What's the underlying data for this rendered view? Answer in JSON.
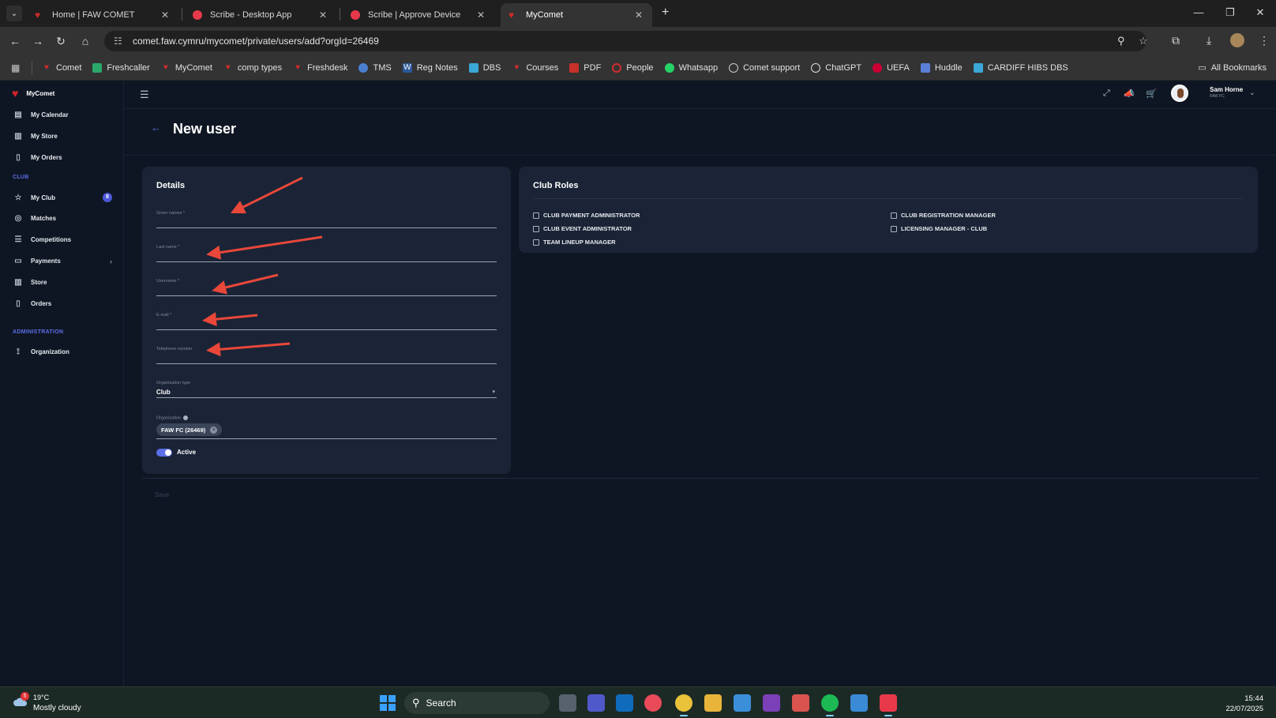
{
  "browser": {
    "tabs": [
      {
        "title": "Home | FAW COMET",
        "icon": "heart-icon",
        "active": false
      },
      {
        "title": "Scribe - Desktop App",
        "icon": "scribe-icon",
        "active": false
      },
      {
        "title": "Scribe | Approve Device",
        "icon": "scribe-icon",
        "active": false
      },
      {
        "title": "MyComet",
        "icon": "heart-icon",
        "active": true
      }
    ],
    "url": "comet.faw.cymru/mycomet/private/users/add?orgId=26469",
    "bookmarks": [
      "Comet",
      "Freshcaller",
      "MyComet",
      "comp types",
      "Freshdesk",
      "TMS",
      "Reg Notes",
      "DBS",
      "Courses",
      "PDF",
      "People",
      "Whatsapp",
      "Comet support",
      "ChatGPT",
      "UEFA",
      "Huddle",
      "CARDIFF HIBS DBS"
    ],
    "all_bookmarks": "All Bookmarks"
  },
  "sidebar": {
    "brand": "MyComet",
    "items_top": [
      "My Calendar",
      "My Store",
      "My Orders"
    ],
    "section_club": "CLUB",
    "items_club": [
      {
        "label": "My Club",
        "badge": "8"
      },
      {
        "label": "Matches"
      },
      {
        "label": "Competitions"
      },
      {
        "label": "Payments"
      },
      {
        "label": "Store"
      },
      {
        "label": "Orders"
      }
    ],
    "section_admin": "ADMINISTRATION",
    "items_admin": [
      "Organization"
    ]
  },
  "header": {
    "user_name": "Sam Horne",
    "user_org": "FAW FC"
  },
  "page": {
    "title": "New user"
  },
  "details": {
    "title": "Details",
    "given_names_label": "Given names *",
    "last_name_label": "Last name *",
    "username_label": "Username *",
    "email_label": "E-mail *",
    "telephone_label": "Telephone number",
    "org_type_label": "Organisation type",
    "org_type_value": "Club",
    "organisation_label": "Organisation",
    "organisation_chip": "FAW FC (26469)",
    "active_label": "Active",
    "active": true
  },
  "club_roles": {
    "title": "Club Roles",
    "roles_left": [
      "CLUB PAYMENT ADMINISTRATOR",
      "CLUB EVENT ADMINISTRATOR",
      "TEAM LINEUP MANAGER"
    ],
    "roles_right": [
      "CLUB REGISTRATION MANAGER",
      "LICENSING MANAGER - CLUB"
    ]
  },
  "actions": {
    "save": "Save"
  },
  "taskbar": {
    "weather_badge": "5",
    "temperature": "19°C",
    "weather": "Mostly cloudy",
    "search": "Search",
    "time": "15:44",
    "date": "22/07/2025"
  },
  "colors": {
    "accent": "#5b6ee8",
    "brand_red": "#d4232b",
    "annotation_arrow": "#e8473a",
    "card_bg": "#1a2436",
    "page_bg": "#0f1623"
  }
}
